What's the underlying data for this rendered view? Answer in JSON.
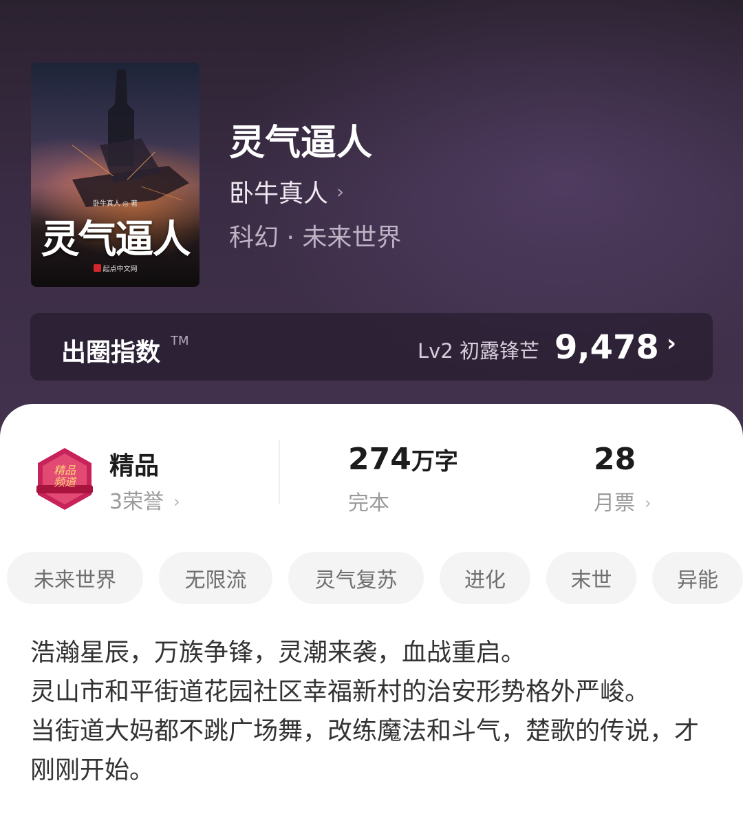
{
  "book": {
    "cover": {
      "author_line": "卧牛真人 ◎ 著",
      "title": "灵气逼人",
      "publisher": "起点中文网"
    },
    "title": "灵气逼人",
    "author": "卧牛真人",
    "genre": "科幻 · 未来世界"
  },
  "index_bar": {
    "label": "出圈指数",
    "tm": "TM",
    "level": "Lv2 初露锋芒",
    "value": "9,478",
    "arrow": "›"
  },
  "stats": {
    "quality": {
      "badge_icon": "premium-badge-icon",
      "title": "精品",
      "subtitle": "3荣誉"
    },
    "words": {
      "number": "274",
      "unit": "万字",
      "status": "完本"
    },
    "tickets": {
      "value": "28",
      "label": "月票"
    }
  },
  "tags": [
    "未来世界",
    "无限流",
    "灵气复苏",
    "进化",
    "末世",
    "异能"
  ],
  "synopsis": [
    "浩瀚星辰，万族争锋，灵潮来袭，血战重启。",
    "灵山市和平街道花园社区幸福新村的治安形势格外严峻。",
    "当街道大妈都不跳广场舞，改练魔法和斗气，楚歌的传说，才刚刚开始。"
  ],
  "colors": {
    "header_bg": "#3a2c44",
    "card_bg": "#ffffff",
    "tag_bg": "#f4f4f4",
    "text_primary": "#1c1c1c",
    "text_secondary": "#9a9a9a"
  }
}
